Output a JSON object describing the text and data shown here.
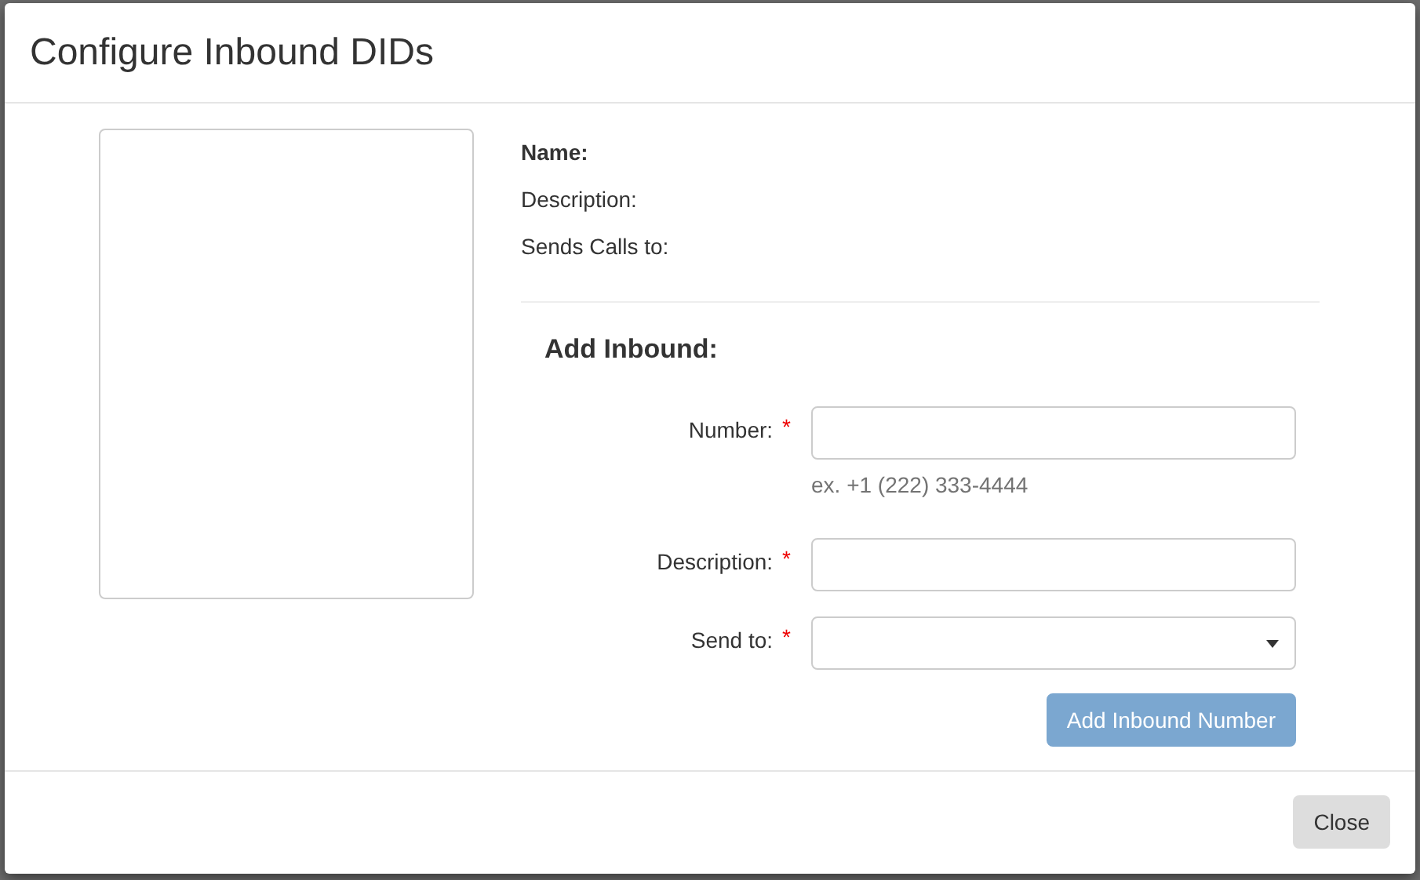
{
  "dialog": {
    "title": "Configure Inbound DIDs"
  },
  "details": [
    {
      "label": "Name:",
      "bold": true
    },
    {
      "label": "Description:",
      "bold": false
    },
    {
      "label": "Sends Calls to:",
      "bold": false
    }
  ],
  "add_inbound": {
    "heading": "Add Inbound:",
    "fields": [
      {
        "kind": "text",
        "label": "Number:",
        "required": true,
        "required_mark": "*",
        "hint": "ex. +1 (222) 333-4444"
      },
      {
        "kind": "text",
        "label": "Description:",
        "required": true,
        "required_mark": "*"
      },
      {
        "kind": "select",
        "label": "Send to:",
        "required": true,
        "required_mark": "*"
      }
    ],
    "submit": {
      "label": "Add Inbound Number",
      "disabled": true
    }
  },
  "footer": {
    "buttons": [
      "Close"
    ]
  }
}
